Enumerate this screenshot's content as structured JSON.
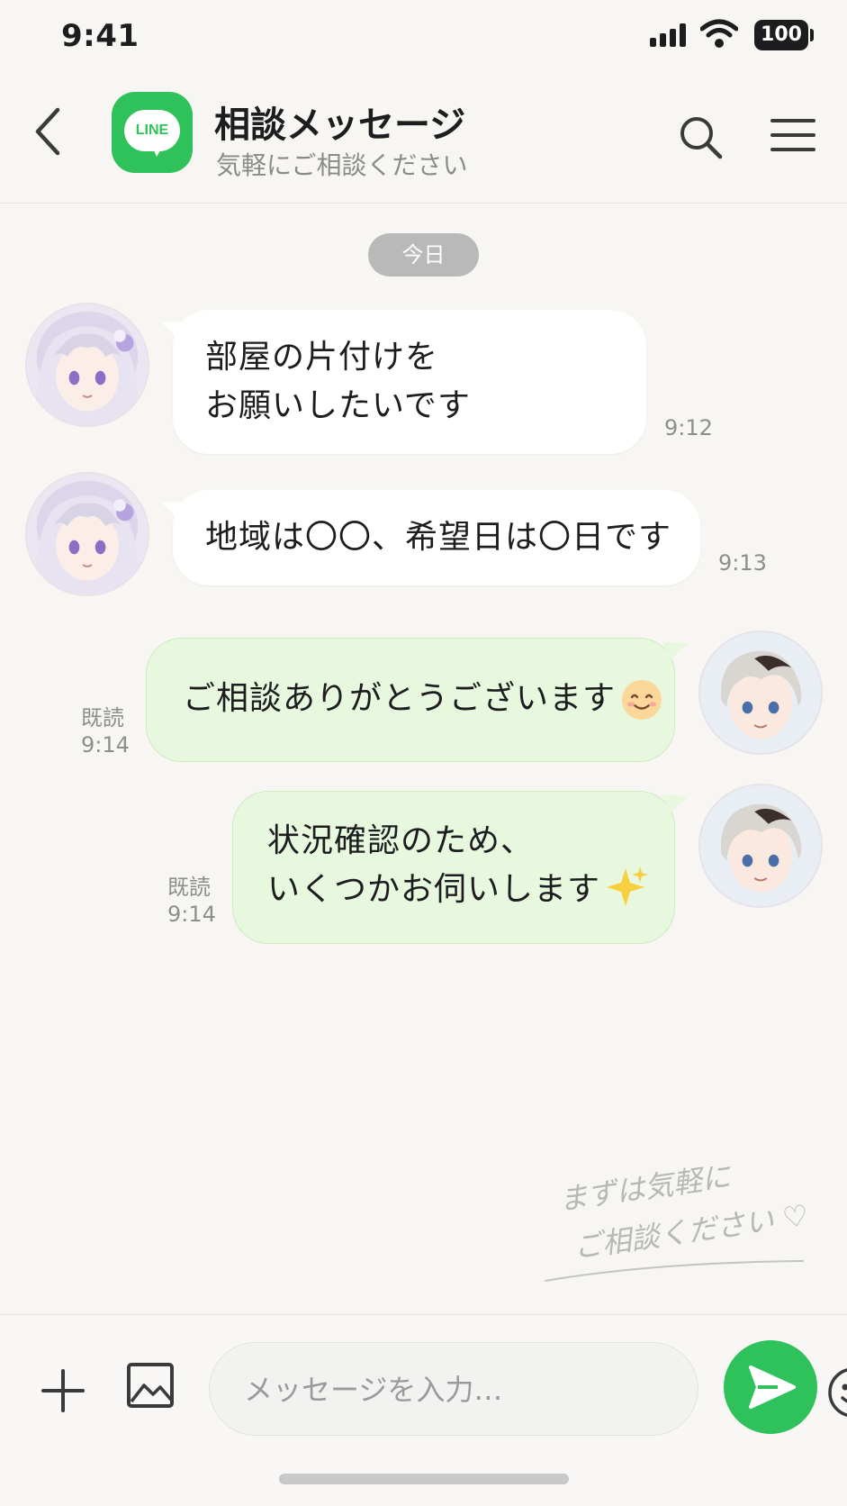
{
  "status_bar": {
    "time": "9:41",
    "battery": "100"
  },
  "header": {
    "title": "相談メッセージ",
    "subtitle": "気軽にご相談ください",
    "logo_text": "LINE",
    "icons": [
      "back-icon",
      "search-icon",
      "menu-icon"
    ]
  },
  "date_divider": "今日",
  "messages": [
    {
      "side": "incoming",
      "text": "部屋の片付けを\nお願いしたいです",
      "time": "9:12"
    },
    {
      "side": "incoming",
      "text": "地域は〇〇、希望日は〇日です",
      "time": "9:13"
    },
    {
      "side": "outgoing",
      "text": "ご相談ありがとうございます",
      "emoji": "smiling-face-emoji",
      "read": "既読",
      "time": "9:14"
    },
    {
      "side": "outgoing",
      "text": "状況確認のため、\nいくつかお伺いします",
      "emoji": "sparkles-emoji",
      "read": "既読",
      "time": "9:14"
    }
  ],
  "note": {
    "line1": "まずは気軽に",
    "line2": "ご相談ください ♡"
  },
  "input_bar": {
    "placeholder": "メッセージを入力…",
    "icons": [
      "plus-icon",
      "image-icon",
      "emoji-icon",
      "send-icon"
    ]
  },
  "colors": {
    "brand_green": "#2fc15a",
    "outgoing_bubble": "#e7f8df",
    "incoming_bubble": "#ffffff",
    "background": "#f7f6f3"
  }
}
